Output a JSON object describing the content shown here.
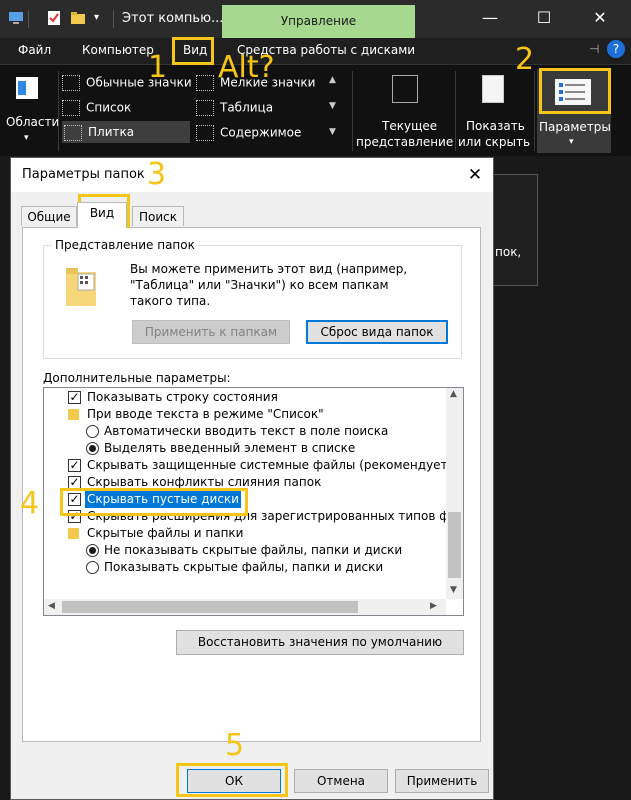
{
  "explorer": {
    "window_title": "Этот компью...",
    "contextual_tab": "Управление",
    "tabs": [
      "Файл",
      "Компьютер",
      "Вид",
      "Средства работы с дисками"
    ],
    "ribbon": {
      "areas_label": "Области",
      "layouts": {
        "row1a": "Обычные значки",
        "row1b": "Мелкие значки",
        "row2a": "Список",
        "row2b": "Таблица",
        "row3a": "Плитка",
        "row3b": "Содержимое"
      },
      "current_view_line1": "Текущее",
      "current_view_line2": "представление",
      "show_hide_line1": "Показать",
      "show_hide_line2": "или скрыть",
      "options_label": "Параметры"
    },
    "behind_text": "пок,"
  },
  "annotations": {
    "n1": "1",
    "alt": "Alt?",
    "n2": "2",
    "n3": "3",
    "n4": "4",
    "n5": "5"
  },
  "dialog": {
    "title": "Параметры папок",
    "tabs": {
      "general": "Общие",
      "view": "Вид",
      "search": "Поиск"
    },
    "folder_views": {
      "title": "Представление папок",
      "desc1": "Вы можете применить этот вид (например,",
      "desc2": "\"Таблица\" или \"Значки\") ко всем папкам",
      "desc3": "такого типа.",
      "apply_button": "Применить к папкам",
      "reset_button": "Сброс вида папок"
    },
    "advanced_label": "Дополнительные параметры:",
    "advanced": {
      "r0": "Показывать строку состояния",
      "r1": "При вводе текста в режиме \"Список\"",
      "r2": "Автоматически вводить текст в поле поиска",
      "r3": "Выделять введенный элемент в списке",
      "r4": "Скрывать защищенные системные файлы (рекомендуется)",
      "r5": "Скрывать конфликты слияния папок",
      "r6": "Скрывать пустые диски",
      "r7": "Скрывать расширения для зарегистрированных типов файлов",
      "r8": "Скрытые файлы и папки",
      "r9": "Не показывать скрытые файлы, папки и диски",
      "r10": "Показывать скрытые файлы, папки и диски"
    },
    "restore_button": "Восстановить значения по умолчанию",
    "ok_button": "ОК",
    "cancel_button": "Отмена",
    "apply_button": "Применить"
  },
  "colors": {
    "annotation": "#f5c518",
    "manage_tab": "#a7d88f",
    "selection": "#0078d7"
  },
  "icons": [
    "computer-icon",
    "checklist-icon",
    "folder-icon",
    "dropdown-icon",
    "minimize-icon",
    "maximize-icon",
    "close-icon",
    "collapse-ribbon-icon",
    "help-icon"
  ]
}
